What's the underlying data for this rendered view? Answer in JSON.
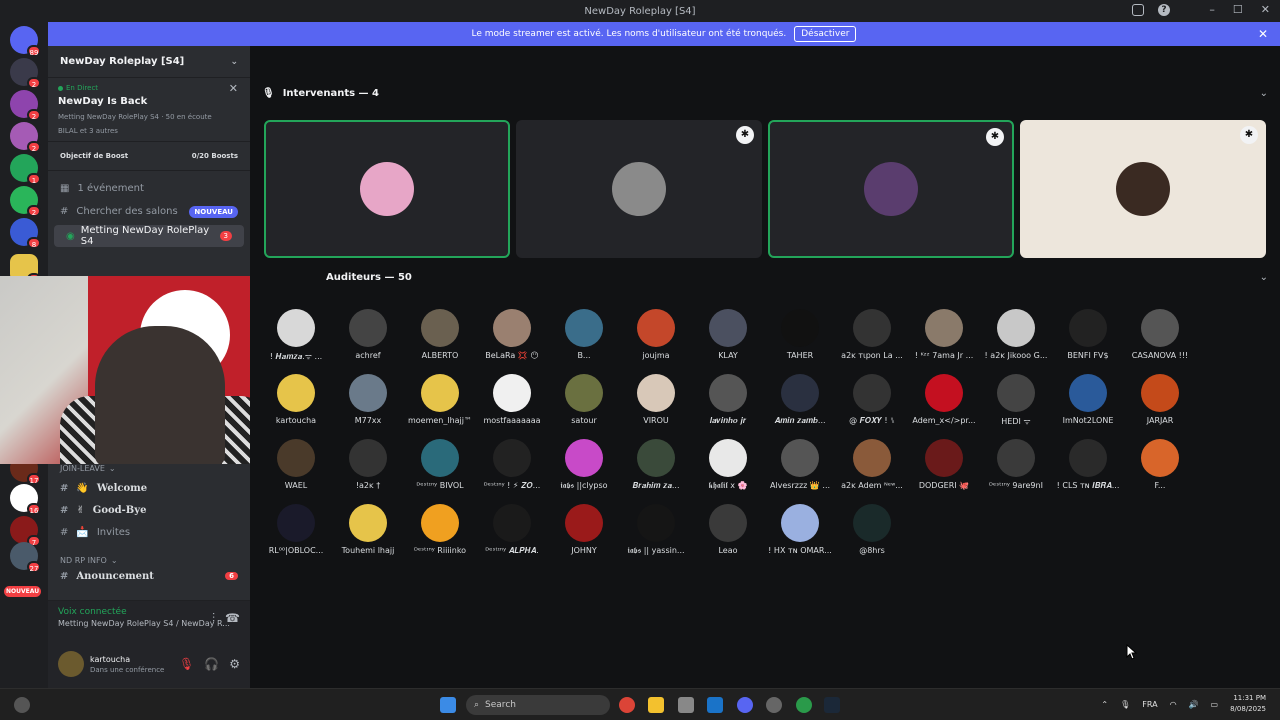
{
  "window": {
    "title": "NewDay Roleplay [S4]"
  },
  "banner": {
    "message": "Le mode streamer est activé. Les noms d'utilisateur ont été tronqués.",
    "button": "Désactiver"
  },
  "guilds": {
    "badges": [
      "89",
      "2",
      "2",
      "2",
      "1",
      "2",
      "8",
      "2",
      "17",
      "16",
      "7",
      "27"
    ],
    "nouveau": "NOUVEAU"
  },
  "sidebar": {
    "server_name": "NewDay Roleplay [S4]",
    "live": {
      "tag": "En Direct",
      "title": "NewDay Is Back",
      "info": "Metting NewDay RolePlay S4 · 50 en écoute",
      "members": "BILAL et 3 autres"
    },
    "boost": {
      "label": "Objectif de Boost",
      "value": "0/20 Boosts"
    },
    "events": "1 événement",
    "search_channels": "Chercher des salons",
    "new_badge": "NOUVEAU",
    "selected_channel": {
      "name": "Metting NewDay RolePlay S4",
      "count": "3"
    },
    "category_join": "JOIN-LEAVE",
    "channels": [
      {
        "emoji": "👋",
        "name": "Welcome",
        "bold": true
      },
      {
        "emoji": "✌",
        "name": "Good-Bye",
        "bold": true
      },
      {
        "emoji": "📩",
        "name": "Invites",
        "bold": false
      }
    ],
    "category_rp": "ND RP INFO",
    "announcement": {
      "name": "Anouncement",
      "count": "6"
    },
    "voice": {
      "status": "Voix connectée",
      "channel": "Metting NewDay RolePlay S4 / NewDay R..."
    },
    "user": {
      "name": "kartoucha",
      "status": "Dans une conférence"
    }
  },
  "main": {
    "speakers_title": "Intervenants — 4",
    "audience_title": "Auditeurs — 50",
    "speakers": [
      {
        "color": "#e7a6c7",
        "speaking": true,
        "star": false
      },
      {
        "color": "#8a8a8a",
        "speaking": false,
        "star": true
      },
      {
        "color": "#5a3d6e",
        "speaking": true,
        "star": true
      },
      {
        "color": "#3a2a22",
        "speaking": false,
        "star": true,
        "bg": "#ede6dc"
      }
    ],
    "audience": [
      {
        "name": "! 𝑯𝒂𝒎𝒛𝒂.ᯤ ...",
        "color": "#d8d8d8"
      },
      {
        "name": "achref",
        "color": "#444"
      },
      {
        "name": "ALBERTO",
        "color": "#6a6050"
      },
      {
        "name": "BeLaRa 💢 😶",
        "color": "#9a8070"
      },
      {
        "name": "B...",
        "color": "#3a6d8a"
      },
      {
        "name": "joujma",
        "color": "#c4472a"
      },
      {
        "name": "KLAY",
        "color": "#4b5060"
      },
      {
        "name": "TAHER",
        "color": "#111"
      },
      {
        "name": "a2ĸ тιpon La ...",
        "color": "#333"
      },
      {
        "name": "! ᴷᶻᶻ 7ama Jr ...",
        "color": "#8a7a6a"
      },
      {
        "name": "! a2ĸ Jikooo G...",
        "color": "#c8c8c8"
      },
      {
        "name": "BENFI FV$",
        "color": "#222"
      },
      {
        "name": "CASANOVA !!!",
        "color": "#555"
      },
      {
        "name": "kartoucha",
        "color": "#e6c44a"
      },
      {
        "name": "M77xx",
        "color": "#6a7a8a"
      },
      {
        "name": "moemen_lhajj™",
        "color": "#e6c44a"
      },
      {
        "name": "mostfaaaaaaa",
        "color": "#f0f0f0"
      },
      {
        "name": "satour",
        "color": "#6a7040"
      },
      {
        "name": "VIROU",
        "color": "#d8c8b8"
      },
      {
        "name": "𝒍𝒂𝒗𝒊𝒏𝒉𝒐 𝒋𝒓",
        "color": "#555"
      },
      {
        "name": "𝑨𝒎𝒊𝒏 𝒛𝒂𝒎𝒃...",
        "color": "#2a3040"
      },
      {
        "name": "@ 𝑭𝑶𝑿𝒀 ! ⑊",
        "color": "#333"
      },
      {
        "name": "Adem_x</>pr...",
        "color": "#c41020"
      },
      {
        "name": "HEDI ᯤ",
        "color": "#444"
      },
      {
        "name": "ImNot2LONE",
        "color": "#2a5a9a"
      },
      {
        "name": "JARJAR",
        "color": "#c44a1a"
      },
      {
        "name": "WAEL",
        "color": "#4a3a2a"
      },
      {
        "name": "!a2ĸ †",
        "color": "#333"
      },
      {
        "name": "ᴰᵉˢᵗᶦⁿʸ BIVOL",
        "color": "#2a6a7a"
      },
      {
        "name": "ᴰᵉˢᵗᶦⁿʸ ! ⚡ 𝒁𝑶...",
        "color": "#222"
      },
      {
        "name": "𝖎𝖆𝖇𝖘 ||clypso",
        "color": "#c84ac8"
      },
      {
        "name": "𝑩𝒓𝒂𝒉𝒊𝒎 𝒛𝒂...",
        "color": "#3a4a3a"
      },
      {
        "name": "𝖐𝖍𝖆𝖑𝖎𝖑 x 🌸",
        "color": "#e8e8e8"
      },
      {
        "name": "Alvesrzzz 👑 ...",
        "color": "#555"
      },
      {
        "name": "a2ĸ Adem ᴺᵉʷ...",
        "color": "#8a5a3a"
      },
      {
        "name": "DODGERI 🐙",
        "color": "#6a1a1a"
      },
      {
        "name": "ᴰᵉˢᵗᶦⁿʸ 9are9nI",
        "color": "#3a3a3a"
      },
      {
        "name": "! CLS ᴛɴ 𝑰𝑩𝑹𝑨...",
        "color": "#2a2a2a"
      },
      {
        "name": "F...",
        "color": "#d8652a"
      },
      {
        "name": "RL⁰⁰|OBLOC...",
        "color": "#1a1a2a"
      },
      {
        "name": "Touhemi lhajj",
        "color": "#e6c44a"
      },
      {
        "name": "ᴰᵉˢᵗᶦⁿʸ Riiiinko",
        "color": "#f0a020"
      },
      {
        "name": "ᴰᵉˢᵗᶦⁿʸ 𝑨𝑳𝑷𝑯𝑨.",
        "color": "#1a1a1a"
      },
      {
        "name": "JOHNY",
        "color": "#9a1a1a"
      },
      {
        "name": "𝖎𝖆𝖇𝖘 || yassin...",
        "color": "#151515"
      },
      {
        "name": "Leao",
        "color": "#3a3a3a"
      },
      {
        "name": "! HX ᴛɴ OMAR...",
        "color": "#9ab0e0"
      },
      {
        "name": "@8hrs",
        "color": "#1a2a2a"
      }
    ]
  },
  "taskbar": {
    "search_placeholder": "Search",
    "lang": "FRA",
    "time": "11:31 PM",
    "date": "8/08/2025"
  }
}
